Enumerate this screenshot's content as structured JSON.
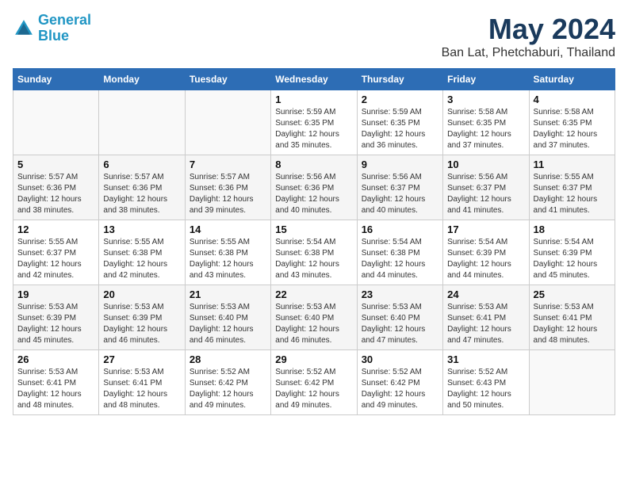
{
  "header": {
    "logo_line1": "General",
    "logo_line2": "Blue",
    "month": "May 2024",
    "location": "Ban Lat, Phetchaburi, Thailand"
  },
  "weekdays": [
    "Sunday",
    "Monday",
    "Tuesday",
    "Wednesday",
    "Thursday",
    "Friday",
    "Saturday"
  ],
  "weeks": [
    [
      {
        "day": "",
        "detail": ""
      },
      {
        "day": "",
        "detail": ""
      },
      {
        "day": "",
        "detail": ""
      },
      {
        "day": "1",
        "detail": "Sunrise: 5:59 AM\nSunset: 6:35 PM\nDaylight: 12 hours\nand 35 minutes."
      },
      {
        "day": "2",
        "detail": "Sunrise: 5:59 AM\nSunset: 6:35 PM\nDaylight: 12 hours\nand 36 minutes."
      },
      {
        "day": "3",
        "detail": "Sunrise: 5:58 AM\nSunset: 6:35 PM\nDaylight: 12 hours\nand 37 minutes."
      },
      {
        "day": "4",
        "detail": "Sunrise: 5:58 AM\nSunset: 6:35 PM\nDaylight: 12 hours\nand 37 minutes."
      }
    ],
    [
      {
        "day": "5",
        "detail": "Sunrise: 5:57 AM\nSunset: 6:36 PM\nDaylight: 12 hours\nand 38 minutes."
      },
      {
        "day": "6",
        "detail": "Sunrise: 5:57 AM\nSunset: 6:36 PM\nDaylight: 12 hours\nand 38 minutes."
      },
      {
        "day": "7",
        "detail": "Sunrise: 5:57 AM\nSunset: 6:36 PM\nDaylight: 12 hours\nand 39 minutes."
      },
      {
        "day": "8",
        "detail": "Sunrise: 5:56 AM\nSunset: 6:36 PM\nDaylight: 12 hours\nand 40 minutes."
      },
      {
        "day": "9",
        "detail": "Sunrise: 5:56 AM\nSunset: 6:37 PM\nDaylight: 12 hours\nand 40 minutes."
      },
      {
        "day": "10",
        "detail": "Sunrise: 5:56 AM\nSunset: 6:37 PM\nDaylight: 12 hours\nand 41 minutes."
      },
      {
        "day": "11",
        "detail": "Sunrise: 5:55 AM\nSunset: 6:37 PM\nDaylight: 12 hours\nand 41 minutes."
      }
    ],
    [
      {
        "day": "12",
        "detail": "Sunrise: 5:55 AM\nSunset: 6:37 PM\nDaylight: 12 hours\nand 42 minutes."
      },
      {
        "day": "13",
        "detail": "Sunrise: 5:55 AM\nSunset: 6:38 PM\nDaylight: 12 hours\nand 42 minutes."
      },
      {
        "day": "14",
        "detail": "Sunrise: 5:55 AM\nSunset: 6:38 PM\nDaylight: 12 hours\nand 43 minutes."
      },
      {
        "day": "15",
        "detail": "Sunrise: 5:54 AM\nSunset: 6:38 PM\nDaylight: 12 hours\nand 43 minutes."
      },
      {
        "day": "16",
        "detail": "Sunrise: 5:54 AM\nSunset: 6:38 PM\nDaylight: 12 hours\nand 44 minutes."
      },
      {
        "day": "17",
        "detail": "Sunrise: 5:54 AM\nSunset: 6:39 PM\nDaylight: 12 hours\nand 44 minutes."
      },
      {
        "day": "18",
        "detail": "Sunrise: 5:54 AM\nSunset: 6:39 PM\nDaylight: 12 hours\nand 45 minutes."
      }
    ],
    [
      {
        "day": "19",
        "detail": "Sunrise: 5:53 AM\nSunset: 6:39 PM\nDaylight: 12 hours\nand 45 minutes."
      },
      {
        "day": "20",
        "detail": "Sunrise: 5:53 AM\nSunset: 6:39 PM\nDaylight: 12 hours\nand 46 minutes."
      },
      {
        "day": "21",
        "detail": "Sunrise: 5:53 AM\nSunset: 6:40 PM\nDaylight: 12 hours\nand 46 minutes."
      },
      {
        "day": "22",
        "detail": "Sunrise: 5:53 AM\nSunset: 6:40 PM\nDaylight: 12 hours\nand 46 minutes."
      },
      {
        "day": "23",
        "detail": "Sunrise: 5:53 AM\nSunset: 6:40 PM\nDaylight: 12 hours\nand 47 minutes."
      },
      {
        "day": "24",
        "detail": "Sunrise: 5:53 AM\nSunset: 6:41 PM\nDaylight: 12 hours\nand 47 minutes."
      },
      {
        "day": "25",
        "detail": "Sunrise: 5:53 AM\nSunset: 6:41 PM\nDaylight: 12 hours\nand 48 minutes."
      }
    ],
    [
      {
        "day": "26",
        "detail": "Sunrise: 5:53 AM\nSunset: 6:41 PM\nDaylight: 12 hours\nand 48 minutes."
      },
      {
        "day": "27",
        "detail": "Sunrise: 5:53 AM\nSunset: 6:41 PM\nDaylight: 12 hours\nand 48 minutes."
      },
      {
        "day": "28",
        "detail": "Sunrise: 5:52 AM\nSunset: 6:42 PM\nDaylight: 12 hours\nand 49 minutes."
      },
      {
        "day": "29",
        "detail": "Sunrise: 5:52 AM\nSunset: 6:42 PM\nDaylight: 12 hours\nand 49 minutes."
      },
      {
        "day": "30",
        "detail": "Sunrise: 5:52 AM\nSunset: 6:42 PM\nDaylight: 12 hours\nand 49 minutes."
      },
      {
        "day": "31",
        "detail": "Sunrise: 5:52 AM\nSunset: 6:43 PM\nDaylight: 12 hours\nand 50 minutes."
      },
      {
        "day": "",
        "detail": ""
      }
    ]
  ]
}
